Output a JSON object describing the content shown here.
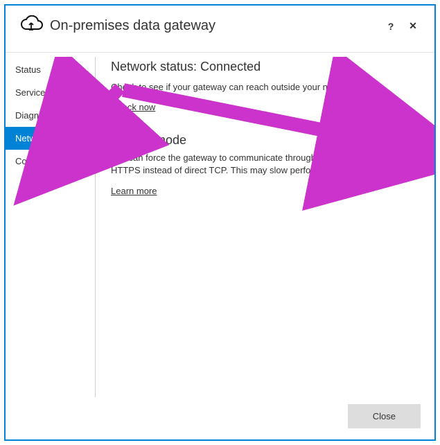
{
  "header": {
    "title": "On-premises data gateway",
    "help_label": "?",
    "close_label": "✕"
  },
  "sidebar": {
    "items": [
      {
        "label": "Status"
      },
      {
        "label": "Service Settings"
      },
      {
        "label": "Diagnostics"
      },
      {
        "label": "Network"
      },
      {
        "label": "Connectors"
      }
    ],
    "active_index": 3
  },
  "network": {
    "status_prefix": "Network status: ",
    "status_value": "Connected",
    "status_desc": "Check to see if your gateway can reach outside your network.",
    "check_now": "Check now",
    "https_heading": "HTTPS mode",
    "https_desc": "You can force the gateway to communicate through Azure Service Bus using HTTPS instead of direct TCP. This may slow performance.",
    "learn_more": "Learn more",
    "https_on": false
  },
  "footer": {
    "close_label": "Close"
  }
}
